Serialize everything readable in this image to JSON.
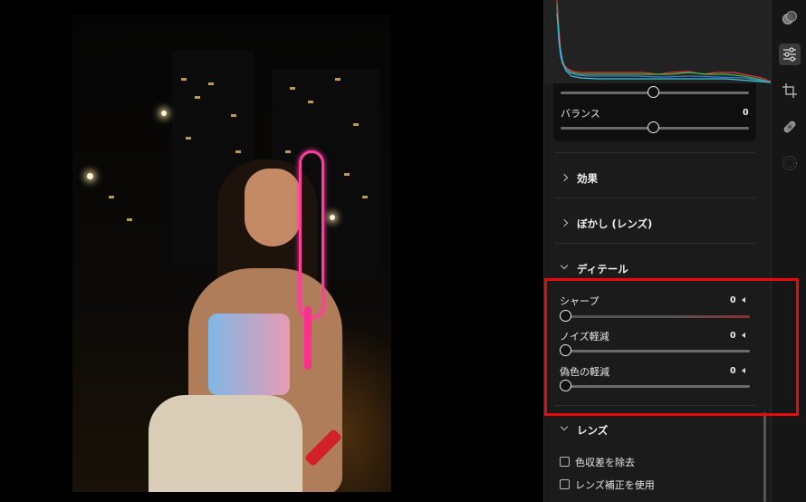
{
  "balance": {
    "label": "バランス",
    "value": "0"
  },
  "sections": {
    "effects": {
      "label": "効果"
    },
    "blur_lens": {
      "label": "ぼかし (レンズ)"
    },
    "detail": {
      "label": "ディテール"
    },
    "lens": {
      "label": "レンズ"
    }
  },
  "detail_sliders": [
    {
      "label": "シャープ",
      "value": "0"
    },
    {
      "label": "ノイズ軽減",
      "value": "0"
    },
    {
      "label": "偽色の軽減",
      "value": "0"
    }
  ],
  "lens_options": [
    {
      "label": "色収差を除去",
      "checked": false
    },
    {
      "label": "レンズ補正を使用",
      "checked": false
    }
  ],
  "tools": [
    {
      "icon": "color-mix-icon",
      "active": false
    },
    {
      "icon": "adjust-sliders-icon",
      "active": true
    },
    {
      "icon": "crop-icon",
      "active": false
    },
    {
      "icon": "healing-bandage-icon",
      "active": false
    },
    {
      "icon": "grain-dots-icon",
      "active": false
    }
  ],
  "colors": {
    "highlight": "#e8090f",
    "hist_red": "#e23b3b",
    "hist_green": "#3fbf4a",
    "hist_blue": "#3d7be0",
    "hist_teal": "#3bc7d3"
  }
}
